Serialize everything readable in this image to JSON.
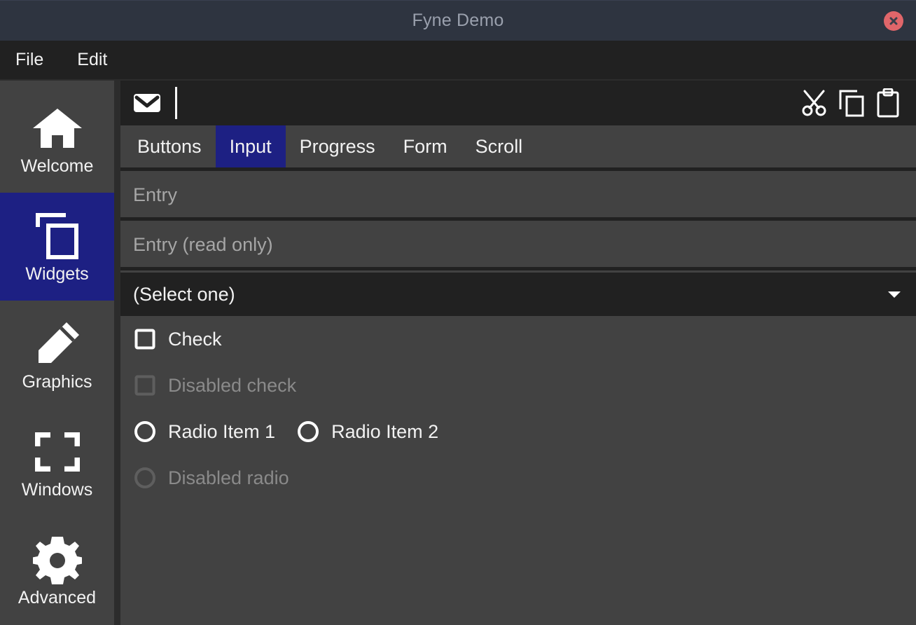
{
  "window": {
    "title": "Fyne Demo",
    "close_icon": "close-circle-icon"
  },
  "menubar": {
    "items": [
      {
        "label": "File"
      },
      {
        "label": "Edit"
      }
    ]
  },
  "sidebar": {
    "items": [
      {
        "label": "Welcome",
        "icon": "home-icon",
        "selected": false
      },
      {
        "label": "Widgets",
        "icon": "copy-pages-icon",
        "selected": true
      },
      {
        "label": "Graphics",
        "icon": "pencil-icon",
        "selected": false
      },
      {
        "label": "Windows",
        "icon": "fullscreen-icon",
        "selected": false
      },
      {
        "label": "Advanced",
        "icon": "gear-icon",
        "selected": false
      }
    ]
  },
  "toolbar": {
    "mail_icon": "mail-icon",
    "cut_icon": "scissors-icon",
    "copy_icon": "copy-icon",
    "paste_icon": "clipboard-icon"
  },
  "tabs": {
    "items": [
      {
        "label": "Buttons",
        "active": false
      },
      {
        "label": "Input",
        "active": true
      },
      {
        "label": "Progress",
        "active": false
      },
      {
        "label": "Form",
        "active": false
      },
      {
        "label": "Scroll",
        "active": false
      }
    ]
  },
  "input_panel": {
    "entry": {
      "placeholder": "Entry",
      "value": ""
    },
    "entry_readonly": {
      "placeholder": "Entry (read only)",
      "value": ""
    },
    "select": {
      "value": "(Select one)",
      "arrow_icon": "chevron-down-icon"
    },
    "check": {
      "label": "Check",
      "checked": false
    },
    "check_disabled": {
      "label": "Disabled check",
      "checked": false
    },
    "radio_1": {
      "label": "Radio Item 1",
      "selected": false
    },
    "radio_2": {
      "label": "Radio Item 2",
      "selected": false
    },
    "radio_disabled": {
      "label": "Disabled radio",
      "selected": false
    }
  },
  "colors": {
    "titlebar": "#2e3440",
    "menubar": "#212121",
    "background": "#424242",
    "accent": "#1d2083",
    "close": "#e0666a",
    "text": "#f2f2f2",
    "placeholder": "#a6a6a6",
    "disabled": "#8a8a8a"
  }
}
